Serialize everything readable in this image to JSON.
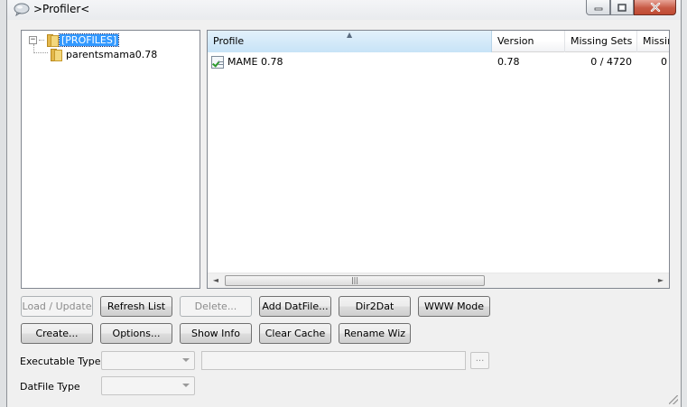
{
  "window": {
    "title": ">Profiler<"
  },
  "tree": {
    "root_label": "[PROFILES]",
    "root_expander": "−",
    "children": [
      {
        "label": "parentsmama0.78"
      }
    ]
  },
  "list": {
    "columns": [
      "Profile",
      "Version",
      "Missing Sets",
      "Missin"
    ],
    "sort_column": "Profile",
    "sort_direction": "ascending",
    "sort_glyph": "▲",
    "rows": [
      {
        "profile": "MAME 0.78",
        "version": "0.78",
        "missing_sets": "0 / 4720",
        "missing_other": "0"
      }
    ],
    "scroll_left_glyph": "◄",
    "scroll_right_glyph": "►",
    "scroll_thumb_glyph": "|||"
  },
  "buttons": {
    "row1": {
      "load_update": "Load / Update",
      "refresh_list": "Refresh List",
      "delete": "Delete...",
      "add_datfile": "Add DatFile...",
      "dir2dat": "Dir2Dat",
      "www_mode": "WWW Mode"
    },
    "row2": {
      "create": "Create...",
      "options": "Options...",
      "show_info": "Show Info",
      "clear_cache": "Clear Cache",
      "rename_wiz": "Rename Wiz"
    }
  },
  "fields": {
    "executable_type_label": "Executable Type",
    "executable_type_value": "",
    "executable_path_value": "",
    "browse_label": "...",
    "datfile_type_label": "DatFile Type",
    "datfile_type_value": ""
  },
  "colors": {
    "selection": "#3399ff",
    "header_sorted": "#c7e3f7",
    "close_button": "#c75a45"
  }
}
